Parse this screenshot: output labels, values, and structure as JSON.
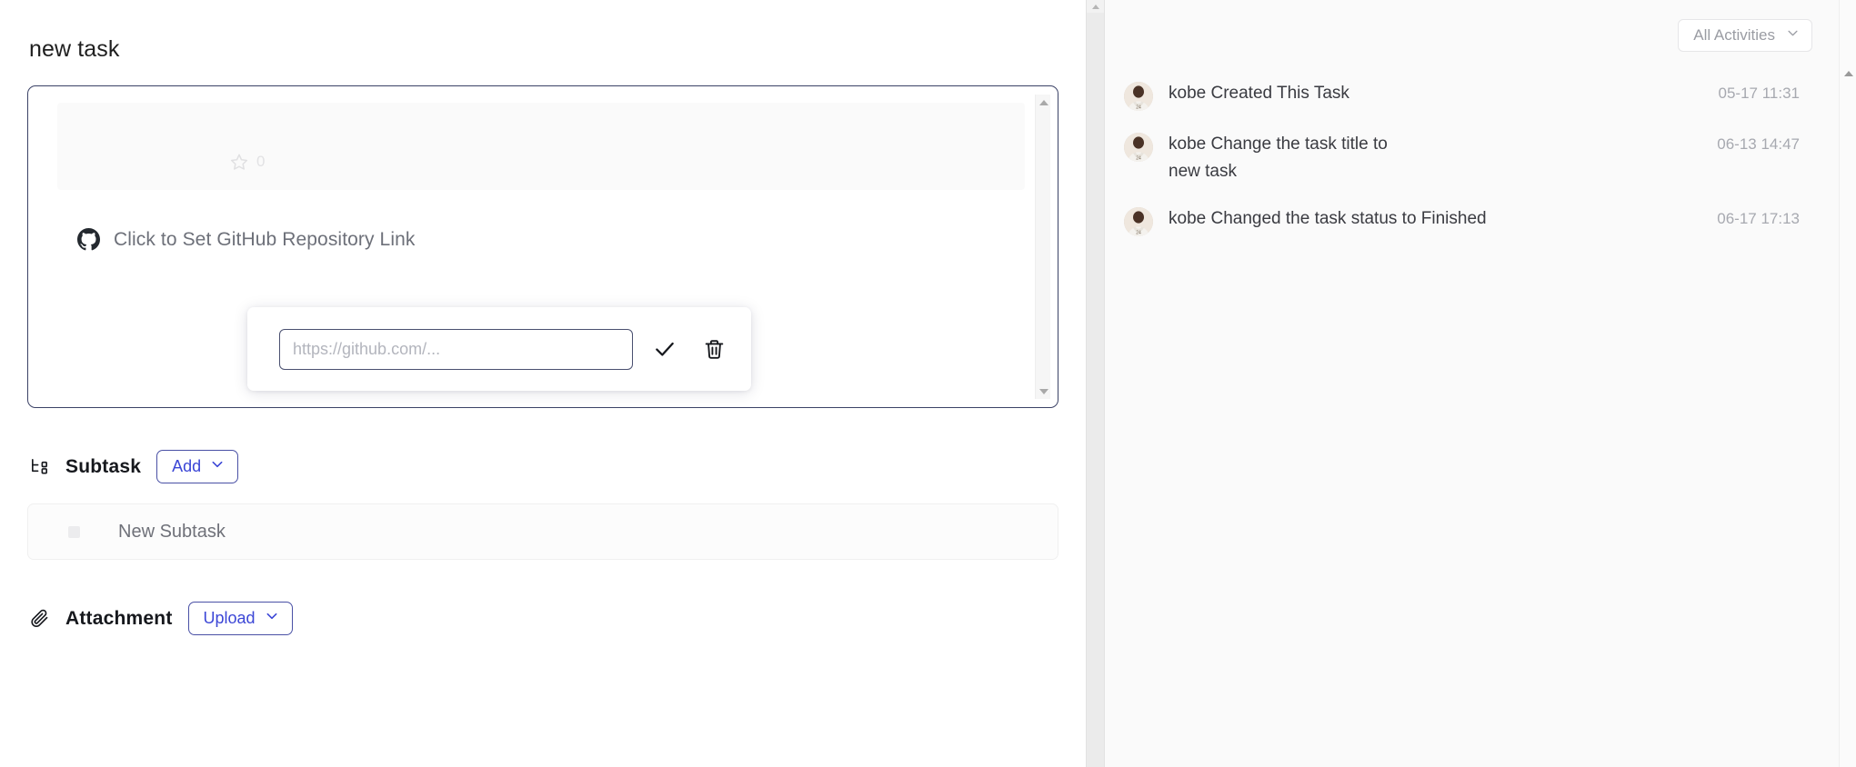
{
  "task": {
    "title": "new task"
  },
  "repo_card": {
    "stars_icon": "star-icon",
    "stars_count": "0",
    "github_icon": "github-icon",
    "link_prompt": "Click to Set GitHub Repository Link",
    "link_input_value": "",
    "link_input_placeholder": "https://github.com/...",
    "confirm_icon": "check-icon",
    "delete_icon": "trash-icon"
  },
  "subtask": {
    "icon": "subtask-tree-icon",
    "title": "Subtask",
    "add_label": "Add",
    "add_chevron": "chevron-down-icon",
    "items": [
      {
        "label": "New Subtask",
        "checked": false
      }
    ]
  },
  "attachment": {
    "icon": "paperclip-icon",
    "title": "Attachment",
    "upload_label": "Upload",
    "upload_chevron": "chevron-down-icon"
  },
  "activities": {
    "filter_label": "All Activities",
    "filter_chevron": "chevron-down-icon",
    "items": [
      {
        "user": "kobe",
        "text": "kobe Created This Task",
        "time": "05-17 11:31",
        "avatar": "user-avatar"
      },
      {
        "user": "kobe",
        "text": "kobe Change the task title to\nnew task",
        "time": "06-13 14:47",
        "avatar": "user-avatar"
      },
      {
        "user": "kobe",
        "text": "kobe Changed the task status to Finished",
        "time": "06-17 17:13",
        "avatar": "user-avatar"
      }
    ]
  },
  "colors": {
    "accent": "#3b46d6",
    "card_border": "#3b4266",
    "muted_text": "#6d7079",
    "panel_bg": "#fafafa"
  }
}
